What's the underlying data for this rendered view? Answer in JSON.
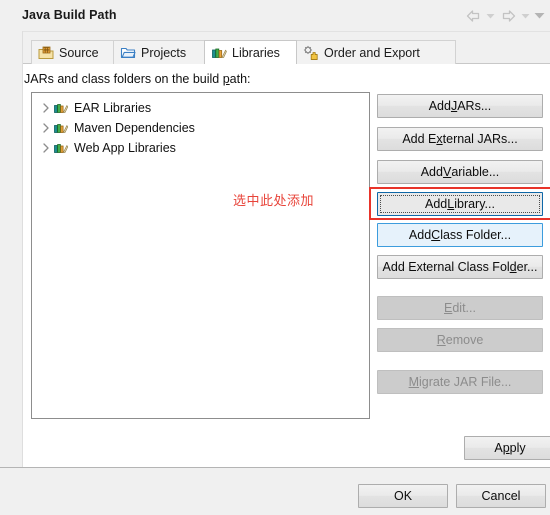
{
  "window": {
    "title": "Java Build Path",
    "nav": {
      "back_icon": "back-arrow-icon",
      "back_dropdown_icon": "chevron-down-icon",
      "forward_icon": "forward-arrow-icon",
      "forward_dropdown_icon": "chevron-down-icon",
      "menu_icon": "chevron-down-icon"
    }
  },
  "tabs": [
    {
      "label": "Source",
      "icon": "source-folder-icon",
      "selected": false
    },
    {
      "label": "Projects",
      "icon": "projects-folder-icon",
      "selected": false
    },
    {
      "label": "Libraries",
      "icon": "libraries-books-icon",
      "selected": true
    },
    {
      "label": "Order and Export",
      "icon": "order-export-icon",
      "selected": false
    }
  ],
  "main": {
    "description_pre": "JARs and class folders on the build ",
    "description_mnemonic": "p",
    "description_post": "ath:",
    "tree_items": [
      {
        "label": "EAR Libraries",
        "icon": "library-icon",
        "expandable": true
      },
      {
        "label": "Maven Dependencies",
        "icon": "library-icon",
        "expandable": true
      },
      {
        "label": "Web App Libraries",
        "icon": "library-icon",
        "expandable": true
      }
    ]
  },
  "buttons": {
    "add_jars": {
      "pre": "Add ",
      "mn": "J",
      "post": "ARs...",
      "state": "normal"
    },
    "add_external_jars": {
      "pre": "Add E",
      "mn": "x",
      "post": "ternal JARs...",
      "state": "normal"
    },
    "add_variable": {
      "pre": "Add ",
      "mn": "V",
      "post": "ariable...",
      "state": "normal"
    },
    "add_library": {
      "pre": "Add ",
      "mn": "L",
      "post": "ibrary...",
      "state": "focused"
    },
    "add_class_folder": {
      "pre": "Add ",
      "mn": "C",
      "post": "lass Folder...",
      "state": "hover"
    },
    "add_external_class_folder": {
      "pre": "Add External Class Fol",
      "mn": "d",
      "post": "er...",
      "state": "normal"
    },
    "edit": {
      "pre": "",
      "mn": "E",
      "post": "dit...",
      "state": "disabled"
    },
    "remove": {
      "pre": "",
      "mn": "R",
      "post": "emove",
      "state": "disabled"
    },
    "migrate_jar_file": {
      "pre": "",
      "mn": "M",
      "post": "igrate JAR File...",
      "state": "disabled"
    }
  },
  "footer": {
    "apply": {
      "pre": "A",
      "mn": "p",
      "post": "ply"
    },
    "ok": "OK",
    "cancel": "Cancel"
  },
  "annotation": {
    "text": "选中此处添加",
    "color": "#e8443a",
    "box_color": "#e8342a",
    "target": "add_library"
  },
  "colors": {
    "dialog_bg": "#f0f0f0",
    "content_bg": "#ffffff",
    "button_face": "#e3e3e3",
    "button_border": "#adadad",
    "focus_border": "#0f68a8",
    "hover_bg": "#e6f2fb",
    "hover_border": "#3c9cdd",
    "disabled_bg": "#cccccc",
    "disabled_text": "#8c8c8c",
    "tree_border": "#8d8d8d"
  }
}
